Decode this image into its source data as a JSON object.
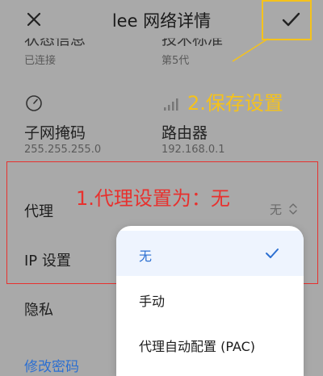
{
  "header": {
    "title": "lee 网络详情"
  },
  "info": {
    "status_label": "状态信息",
    "status_value": "已连接",
    "tech_label": "技术标准",
    "tech_value": "第5代",
    "subnet_label": "子网掩码",
    "subnet_value": "255.255.255.0",
    "router_label": "路由器",
    "router_value": "192.168.0.1"
  },
  "rows": {
    "proxy_label": "代理",
    "proxy_value": "无",
    "ip_label": "IP 设置",
    "privacy_label": "隐私",
    "change_password": "修改密码"
  },
  "annotations": {
    "save": "2.保存设置",
    "proxy": "1.代理设置为：无"
  },
  "menu": {
    "options": [
      "无",
      "手动",
      "代理自动配置 (PAC)"
    ],
    "selected": "无"
  },
  "colors": {
    "accent_blue": "#2c6fd1",
    "annotation_yellow": "#f5c21b",
    "annotation_red": "#e8312e"
  }
}
